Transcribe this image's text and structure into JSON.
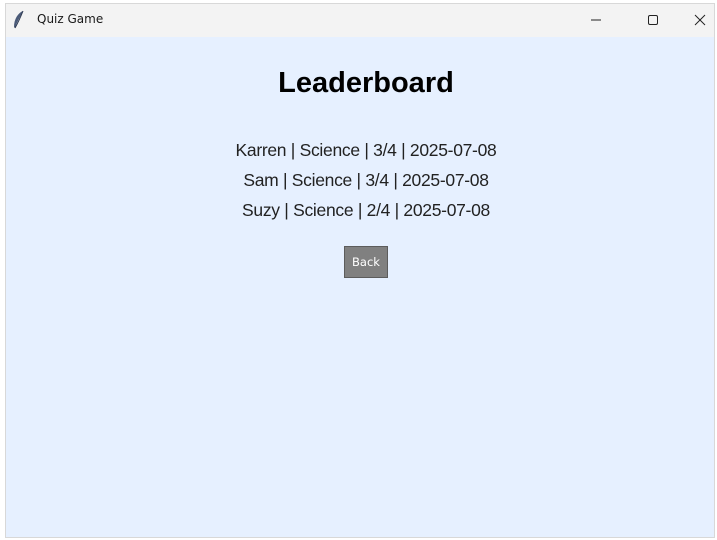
{
  "window": {
    "title": "Quiz Game",
    "icon": "feather-icon"
  },
  "leaderboard": {
    "heading": "Leaderboard",
    "entries": [
      "Karren | Science | 3/4 | 2025-07-08",
      "Sam | Science | 3/4 | 2025-07-08",
      "Suzy | Science | 2/4 | 2025-07-08"
    ],
    "back_label": "Back"
  },
  "colors": {
    "background": "#e6f0ff",
    "button": "#808080",
    "titlebar": "#f3f3f3"
  }
}
